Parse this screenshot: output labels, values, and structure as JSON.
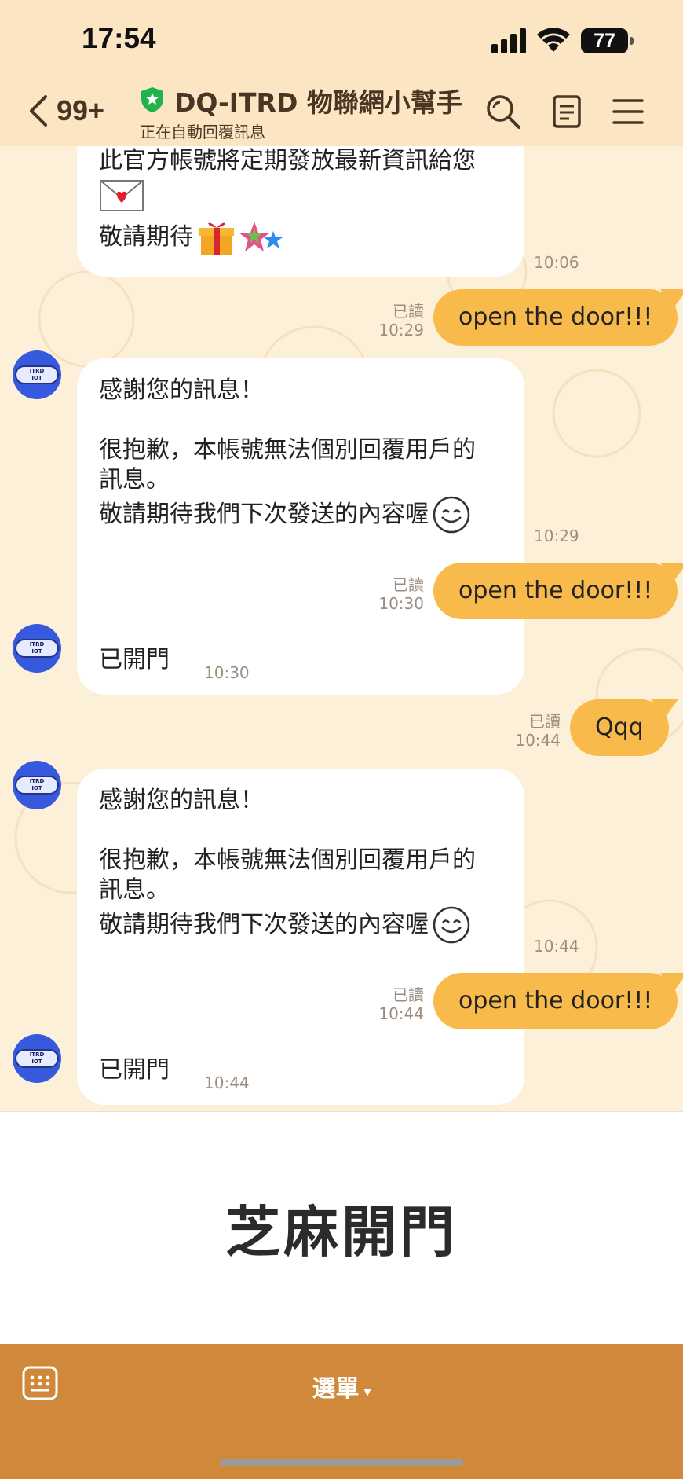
{
  "status_bar": {
    "time": "17:54",
    "battery": "77"
  },
  "header": {
    "back_count": "99+",
    "title": "DQ-ITRD 物聯網小幫手",
    "subtitle": "正在自動回覆訊息",
    "icons": [
      "search-icon",
      "notes-icon",
      "menu-icon"
    ]
  },
  "avatar_text": [
    "ITRD",
    "IOT"
  ],
  "messages": {
    "m1": {
      "line1": "此官方帳號將定期發放最新資訊給您",
      "line3": "敬請期待",
      "time": "10:06"
    },
    "m2": {
      "text": "open the door!!!",
      "read": "已讀",
      "time": "10:29"
    },
    "m3": {
      "line1": "感謝您的訊息！",
      "line2": "很抱歉，本帳號無法個別回覆用戶的",
      "line3": "訊息。",
      "line4": "敬請期待我們下次發送的內容喔",
      "time": "10:29"
    },
    "m4": {
      "text": "open the door!!!",
      "read": "已讀",
      "time": "10:30"
    },
    "m5": {
      "text": "已開門",
      "time": "10:30"
    },
    "m6": {
      "text": "Qqq",
      "read": "已讀",
      "time": "10:44"
    },
    "m7": {
      "line1": "感謝您的訊息！",
      "line2": "很抱歉，本帳號無法個別回覆用戶的",
      "line3": "訊息。",
      "line4": "敬請期待我們下次發送的內容喔",
      "time": "10:44"
    },
    "m8": {
      "text": "open the door!!!",
      "read": "已讀",
      "time": "10:44"
    },
    "m9": {
      "text": "已開門",
      "time": "10:44"
    }
  },
  "rich_menu": {
    "label": "芝麻開門"
  },
  "bottom_bar": {
    "menu_label": "選單",
    "caret": "▾"
  },
  "colors": {
    "header_bg": "#fce5c2",
    "chat_bg": "#fdf0d9",
    "outgoing_bubble": "#f8bb4b",
    "bottom_bar": "#d0883a",
    "avatar": "#3659de"
  }
}
